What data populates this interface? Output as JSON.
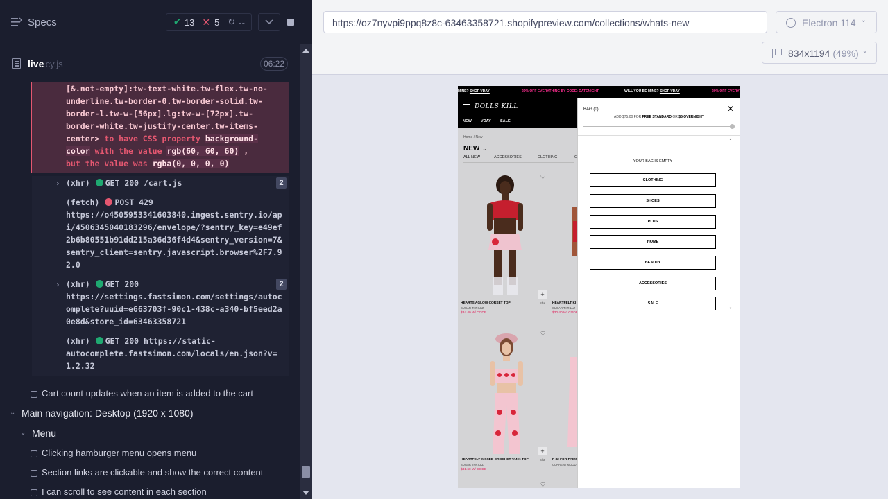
{
  "reporter": {
    "title": "Specs",
    "stats": {
      "passed": "13",
      "failed": "5",
      "pending": "--"
    },
    "file": {
      "name": "live",
      "ext": ".cy.js",
      "duration": "06:22"
    },
    "error_lines": [
      "[&.not-empty]:tw-text-white.tw-flex.tw-no-",
      "underline.tw-border-0.tw-border-solid.tw-",
      "border-l.tw-w-[56px].lg:tw-w-[72px].tw-",
      "border-white.tw-justify-center.tw-items-"
    ],
    "error_tail": {
      "selector_end": "center>",
      "phrase1": "to have CSS property",
      "prop": "background-",
      "prop2": "color",
      "phrase2": "with the value",
      "expected": "rgb(60, 60, 60)",
      "comma": ",",
      "phrase3": "but the value was",
      "actual": "rgba(0, 0, 0, 0)"
    },
    "commands": [
      {
        "type": "(xhr)",
        "status_color": "green",
        "text": "GET 200 /cart.js",
        "count": "2"
      },
      {
        "type": "(fetch)",
        "status_color": "red",
        "text": "POST 429",
        "detail": "https://o4505953341603840.ingest.sentry.io/api/4506345040183296/envelope/?sentry_key=e49ef2b6b80551b91dd215a36d36f4d4&sentry_version=7&sentry_client=sentry.javascript.browser%2F7.92.0"
      },
      {
        "type": "(xhr)",
        "status_color": "green",
        "text": "GET 200",
        "detail": "https://settings.fastsimon.com/settings/autocomplete?uuid=e663703f-90c1-438c-a340-bf5eed2a0e8d&store_id=63463358721",
        "count": "2"
      },
      {
        "type": "(xhr)",
        "status_color": "green",
        "text": "GET 200 https://static-",
        "detail": "autocomplete.fastsimon.com/locals/en.json?v=1.2.32"
      }
    ],
    "tests": [
      {
        "kind": "test",
        "label": "Cart count updates when an item is added to the cart"
      },
      {
        "kind": "suite",
        "label": "Main navigation: Desktop (1920 x 1080)"
      },
      {
        "kind": "suite",
        "label": "Menu"
      },
      {
        "kind": "test",
        "label": "Clicking hamburger menu opens menu"
      },
      {
        "kind": "test",
        "label": "Section links are clickable and show the correct content"
      },
      {
        "kind": "test",
        "label": "I can scroll to see content in each section"
      }
    ]
  },
  "aut": {
    "url": "https://oz7nyvpi9ppq8z8c-63463358721.shopifypreview.com/collections/whats-new",
    "browser": "Electron 114",
    "viewport": "834x1194",
    "scale": "(49%)"
  },
  "store": {
    "ticker": [
      {
        "text": "MINE? ",
        "link": "SHOP VDAY",
        "color": "white"
      },
      {
        "text": "20% OFF EVERYTHING BY CODE: DATENIGHT",
        "color": "pink"
      },
      {
        "text": "WILL YOU BE MINE? ",
        "link": "SHOP VDAY",
        "color": "white"
      },
      {
        "text": "20% OFF EVERYTH",
        "color": "pink"
      }
    ],
    "logo": "DOLLS KILL",
    "nav": [
      "NEW",
      "VDAY",
      "SALE"
    ],
    "breadcrumb": {
      "home": "Home",
      "sep": " / ",
      "current": "New"
    },
    "collection_title": "NEW",
    "subnav": [
      "ALL NEW",
      "ACCESSORIES",
      "CLOTHING",
      "HO"
    ],
    "products": [
      {
        "name": "HEARTS AGLOW CORSET TOP",
        "brand": "SUGAR THRILLZ",
        "price": "$34.40 W/ CODE"
      },
      {
        "name": "HEARTFELT KI",
        "brand": "SUGAR THRILLZ",
        "price": "$30.40 W/ CODE"
      },
      {
        "name": "HEARTFELT KISSED CROCHET TANK TOP",
        "brand": "SUGAR THRILLZ",
        "price": "$41.60 W/ CODE"
      },
      {
        "name": "P 32 FOR PAIRS",
        "brand": "CURRENT MOOD",
        "price": ""
      }
    ],
    "side_labels": [
      "Sha",
      "Sha"
    ]
  },
  "cart": {
    "title": "BAG (0)",
    "note_pre": "ADD $75.00 FOR ",
    "note_bold": "FREE STANDARD",
    "note_mid": " OR ",
    "note_bold2": "$5 OVERNIGHT",
    "free_shipping_progress": 1.0,
    "empty": "YOUR BAG IS EMPTY",
    "categories": [
      "CLOTHING",
      "SHOES",
      "PLUS",
      "HOME",
      "BEAUTY",
      "ACCESSORIES",
      "SALE"
    ]
  },
  "colors": {
    "pass": "#1fa971",
    "fail": "#e45770",
    "accent_pink": "#ff2f92"
  }
}
